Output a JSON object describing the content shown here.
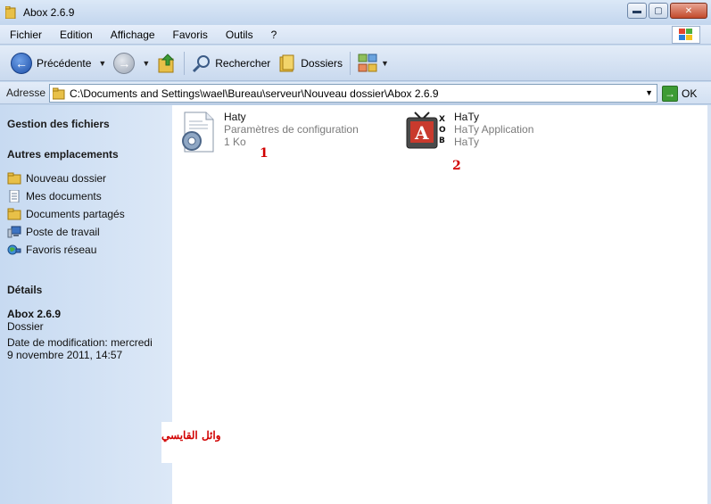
{
  "window": {
    "title": "Abox 2.6.9",
    "buttons": {
      "minimize": "▬",
      "maximize": "▢",
      "close": "✕"
    }
  },
  "menu": [
    "Fichier",
    "Edition",
    "Affichage",
    "Favoris",
    "Outils",
    "?"
  ],
  "toolbar": {
    "back_label": "Précédente",
    "search_label": "Rechercher",
    "folders_label": "Dossiers"
  },
  "address": {
    "label": "Adresse",
    "path": "C:\\Documents and Settings\\wael\\Bureau\\serveur\\Nouveau dossier\\Abox 2.6.9",
    "go_label": "OK"
  },
  "sidebar": {
    "file_tasks_heading": "Gestion des fichiers",
    "other_places_heading": "Autres emplacements",
    "places": [
      {
        "label": "Nouveau dossier",
        "icon": "folder-icon"
      },
      {
        "label": "Mes documents",
        "icon": "documents-icon"
      },
      {
        "label": "Documents partagés",
        "icon": "folder-icon"
      },
      {
        "label": "Poste de travail",
        "icon": "computer-icon"
      },
      {
        "label": "Favoris réseau",
        "icon": "network-icon"
      }
    ],
    "details_heading": "Détails",
    "details": {
      "name": "Abox 2.6.9",
      "type": "Dossier",
      "modified_line1": "Date de modification: mercredi",
      "modified_line2": "9 novembre 2011, 14:57"
    }
  },
  "files": [
    {
      "name": "Haty",
      "type": "Paramètres de configuration",
      "info": "1 Ko",
      "icon": "config-file-icon",
      "marker": "1"
    },
    {
      "name": "HaTy",
      "type": "HaTy Application",
      "info": "HaTy",
      "icon": "application-icon",
      "marker": "2"
    }
  ],
  "watermark": "وائل القايسي",
  "colors": {
    "marker_red": "#d10000",
    "pane_blue": "#c7daf1"
  }
}
